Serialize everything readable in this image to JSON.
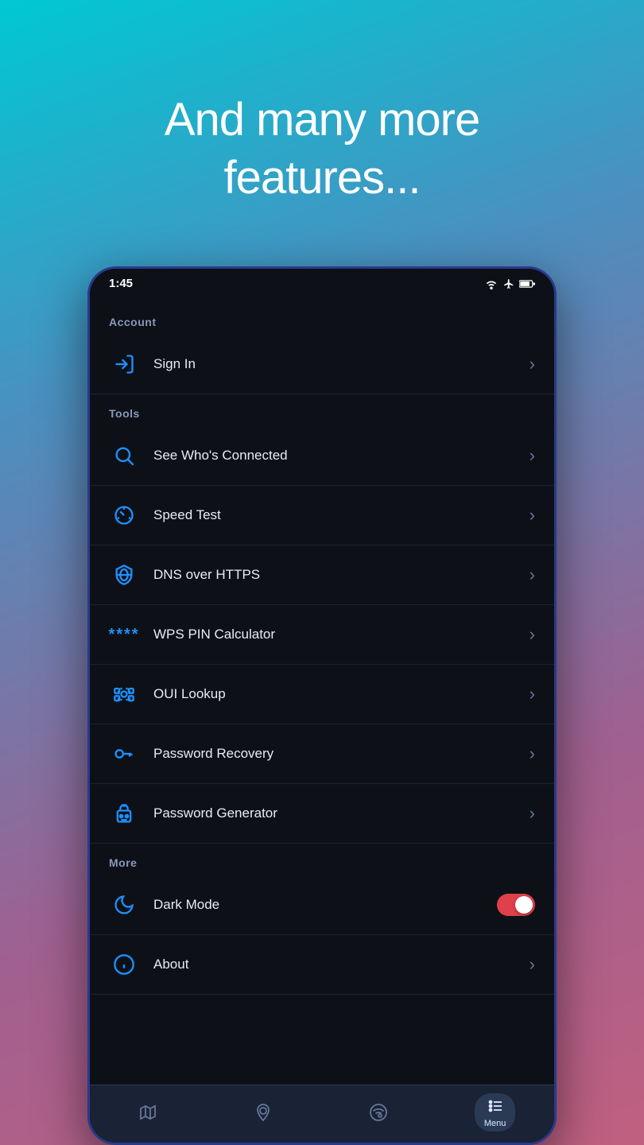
{
  "hero": {
    "line1": "And many more",
    "line2": "features..."
  },
  "status_bar": {
    "time": "1:45"
  },
  "sections": [
    {
      "label": "Account",
      "items": [
        {
          "id": "sign-in",
          "label": "Sign In",
          "icon": "sign-in",
          "has_chevron": true,
          "has_toggle": false
        }
      ]
    },
    {
      "label": "Tools",
      "items": [
        {
          "id": "see-whos-connected",
          "label": "See Who's Connected",
          "icon": "search",
          "has_chevron": true,
          "has_toggle": false
        },
        {
          "id": "speed-test",
          "label": "Speed Test",
          "icon": "speedometer",
          "has_chevron": true,
          "has_toggle": false
        },
        {
          "id": "dns-over-https",
          "label": "DNS over HTTPS",
          "icon": "shield-globe",
          "has_chevron": true,
          "has_toggle": false
        },
        {
          "id": "wps-pin",
          "label": "WPS PIN Calculator",
          "icon": "wps-dots",
          "has_chevron": true,
          "has_toggle": false
        },
        {
          "id": "oui-lookup",
          "label": "OUI Lookup",
          "icon": "eye-scan",
          "has_chevron": true,
          "has_toggle": false
        },
        {
          "id": "password-recovery",
          "label": "Password Recovery",
          "icon": "key",
          "has_chevron": true,
          "has_toggle": false
        },
        {
          "id": "password-generator",
          "label": "Password Generator",
          "icon": "robot-lock",
          "has_chevron": true,
          "has_toggle": false
        }
      ]
    },
    {
      "label": "More",
      "items": [
        {
          "id": "dark-mode",
          "label": "Dark Mode",
          "icon": "moon",
          "has_chevron": false,
          "has_toggle": true
        },
        {
          "id": "about",
          "label": "About",
          "icon": "info-circle",
          "has_chevron": true,
          "has_toggle": false
        }
      ]
    }
  ],
  "bottom_nav": [
    {
      "id": "map",
      "label": "",
      "icon": "map",
      "active": false
    },
    {
      "id": "location",
      "label": "",
      "icon": "location",
      "active": false
    },
    {
      "id": "wifi",
      "label": "",
      "icon": "wifi-circle",
      "active": false
    },
    {
      "id": "menu",
      "label": "Menu",
      "icon": "menu-list",
      "active": true
    }
  ]
}
